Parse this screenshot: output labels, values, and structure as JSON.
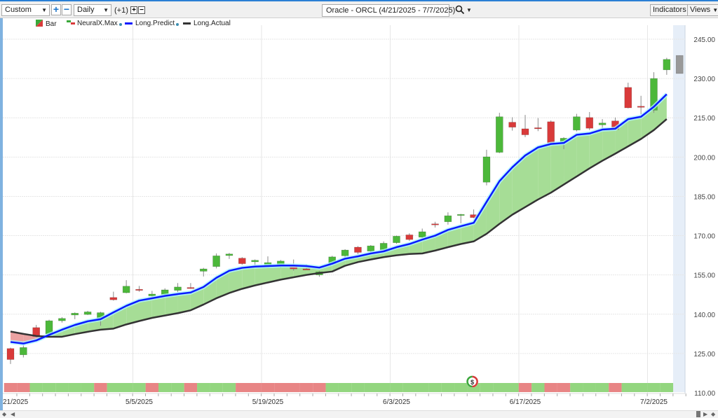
{
  "toolbar": {
    "range_select": "Custom",
    "zoom_in": "+",
    "zoom_out": "−",
    "interval_select": "Daily",
    "offset_label": "(+1)",
    "offset_plus": "+",
    "offset_minus": "−",
    "symbol_search": "Oracle - ORCL (4/21/2025 - 7/7/2025)",
    "search_icon": "magnifier-icon",
    "indicators": "Indicators",
    "views": "Views"
  },
  "legend": [
    {
      "label": "Bar",
      "color": "#d93a3a"
    },
    {
      "label": "NeuralX.Max",
      "color": "#3aa83a"
    },
    {
      "label": "Long.Predict",
      "color": "#0a1aff"
    },
    {
      "label": "Long.Actual",
      "color": "#333333"
    }
  ],
  "chart_data": {
    "type": "candlestick",
    "title": "Oracle - ORCL (4/21/2025 - 7/7/2025)",
    "ylim": [
      110,
      245
    ],
    "y_ticks": [
      "245.00",
      "230.00",
      "215.00",
      "200.00",
      "185.00",
      "170.00",
      "155.00",
      "140.00",
      "125.00",
      "110.00"
    ],
    "y_tick_values": [
      245,
      230,
      215,
      200,
      185,
      170,
      155,
      140,
      125,
      110
    ],
    "x_ticks": [
      {
        "index": 0,
        "label": "21/2025"
      },
      {
        "index": 10,
        "label": "5/5/2025"
      },
      {
        "index": 20,
        "label": "5/19/2025"
      },
      {
        "index": 30,
        "label": "6/3/2025"
      },
      {
        "index": 40,
        "label": "6/17/2025"
      },
      {
        "index": 50,
        "label": "7/2/2025"
      }
    ],
    "candles_ohlc": [
      [
        126.9,
        127.2,
        121.0,
        122.7
      ],
      [
        124.5,
        128.1,
        123.5,
        127.3
      ],
      [
        134.9,
        135.9,
        131.2,
        131.5
      ],
      [
        132.5,
        137.9,
        132.4,
        137.5
      ],
      [
        137.5,
        138.9,
        136.8,
        138.4
      ],
      [
        139.7,
        140.7,
        138.1,
        140.4
      ],
      [
        139.9,
        141.3,
        139.7,
        140.9
      ],
      [
        138.4,
        140.9,
        135.6,
        140.6
      ],
      [
        146.4,
        148.6,
        145.2,
        145.5
      ],
      [
        148.2,
        153.0,
        148.0,
        150.7
      ],
      [
        149.5,
        150.8,
        148.6,
        149.4
      ],
      [
        147.0,
        148.9,
        145.7,
        147.7
      ],
      [
        147.5,
        149.9,
        147.3,
        149.3
      ],
      [
        149.1,
        151.9,
        148.4,
        150.4
      ],
      [
        150.2,
        151.9,
        149.7,
        150.0
      ],
      [
        156.4,
        157.7,
        154.4,
        157.3
      ],
      [
        158.2,
        163.2,
        157.5,
        162.3
      ],
      [
        162.4,
        163.4,
        161.1,
        163.0
      ],
      [
        161.4,
        161.8,
        158.9,
        159.3
      ],
      [
        160.0,
        160.9,
        158.6,
        160.6
      ],
      [
        158.2,
        162.1,
        157.7,
        159.7
      ],
      [
        158.7,
        160.7,
        157.7,
        160.3
      ],
      [
        158.4,
        160.9,
        156.6,
        157.3
      ],
      [
        157.3,
        159.1,
        157.0,
        157.2
      ],
      [
        155.0,
        156.6,
        154.3,
        156.2
      ],
      [
        159.3,
        162.3,
        159.1,
        161.9
      ],
      [
        162.3,
        164.8,
        161.8,
        164.5
      ],
      [
        165.6,
        166.0,
        162.9,
        163.6
      ],
      [
        164.1,
        166.4,
        163.6,
        166.1
      ],
      [
        164.6,
        167.8,
        164.3,
        167.1
      ],
      [
        167.3,
        170.0,
        166.9,
        169.8
      ],
      [
        170.3,
        170.9,
        168.0,
        168.5
      ],
      [
        169.4,
        172.7,
        169.1,
        171.5
      ],
      [
        174.5,
        175.3,
        173.1,
        174.4
      ],
      [
        175.3,
        178.9,
        174.2,
        177.6
      ],
      [
        178.0,
        178.3,
        174.7,
        178.1
      ],
      [
        178.0,
        180.0,
        176.7,
        176.9
      ],
      [
        190.4,
        202.8,
        189.2,
        200.1
      ],
      [
        201.8,
        216.9,
        201.5,
        215.4
      ],
      [
        213.3,
        215.2,
        210.1,
        211.4
      ],
      [
        210.8,
        216.1,
        207.6,
        208.5
      ],
      [
        211.2,
        214.9,
        209.9,
        211.1
      ],
      [
        213.5,
        214.0,
        205.3,
        205.5
      ],
      [
        205.7,
        207.6,
        203.0,
        207.2
      ],
      [
        210.3,
        216.5,
        209.8,
        215.4
      ],
      [
        215.1,
        217.2,
        210.3,
        211.0
      ],
      [
        212.3,
        214.5,
        210.8,
        213.0
      ],
      [
        213.8,
        215.1,
        210.3,
        210.5
      ],
      [
        226.6,
        228.4,
        218.6,
        218.8
      ],
      [
        219.4,
        223.4,
        216.3,
        219.3
      ],
      [
        217.9,
        232.4,
        216.9,
        230.0
      ],
      [
        233.3,
        237.9,
        231.4,
        237.3
      ],
      [
        231.9,
        238.8,
        231.9,
        238.8
      ]
    ],
    "series": [
      {
        "name": "Long.Predict",
        "color": "#0a1aff",
        "values": [
          129.4,
          128.8,
          130.0,
          132.1,
          134.1,
          135.9,
          137.3,
          138.1,
          140.7,
          143.2,
          145.2,
          146.1,
          147.0,
          147.7,
          148.3,
          150.4,
          153.9,
          156.6,
          157.7,
          158.2,
          158.4,
          158.6,
          158.6,
          158.4,
          157.8,
          159.3,
          161.2,
          162.1,
          163.2,
          164.0,
          165.6,
          166.8,
          168.5,
          170.0,
          172.2,
          173.6,
          174.9,
          182.9,
          190.8,
          196.1,
          200.6,
          203.7,
          205.0,
          205.4,
          208.5,
          209.0,
          210.5,
          210.8,
          214.5,
          215.4,
          219.2,
          224.0
        ]
      },
      {
        "name": "Long.Actual",
        "color": "#333333",
        "values": [
          133.4,
          132.5,
          131.7,
          131.4,
          131.4,
          132.4,
          133.3,
          134.1,
          134.5,
          136.1,
          137.4,
          138.6,
          139.5,
          140.4,
          141.5,
          143.7,
          146.1,
          148.1,
          149.7,
          151.0,
          152.1,
          153.2,
          154.1,
          155.0,
          155.7,
          156.3,
          158.5,
          159.9,
          160.9,
          161.8,
          162.5,
          163.0,
          163.2,
          164.3,
          165.6,
          166.8,
          167.8,
          170.7,
          174.5,
          178.0,
          180.9,
          183.8,
          186.4,
          189.5,
          192.6,
          195.7,
          198.6,
          201.3,
          204.1,
          206.9,
          210.3,
          214.5
        ]
      }
    ],
    "signals": [
      "down",
      "down",
      "up",
      "up",
      "up",
      "up",
      "up",
      "down",
      "up",
      "up",
      "up",
      "down",
      "up",
      "up",
      "down",
      "up",
      "up",
      "up",
      "down",
      "down",
      "down",
      "down",
      "down",
      "down",
      "down",
      "up",
      "up",
      "up",
      "up",
      "up",
      "up",
      "up",
      "up",
      "up",
      "up",
      "up",
      "up",
      "up",
      "up",
      "up",
      "down",
      "up",
      "down",
      "down",
      "up",
      "up",
      "up",
      "down",
      "up",
      "up",
      "up",
      "up"
    ],
    "signal_marker": {
      "index": 36,
      "label": "$"
    },
    "colors": {
      "up": "#4cb83a",
      "down": "#d93a3a",
      "live": "#999999",
      "signal_up": "#93d67f",
      "signal_down": "#e88585",
      "fill_up": "#a6dd96",
      "fill_down": "#eba2a2"
    }
  }
}
